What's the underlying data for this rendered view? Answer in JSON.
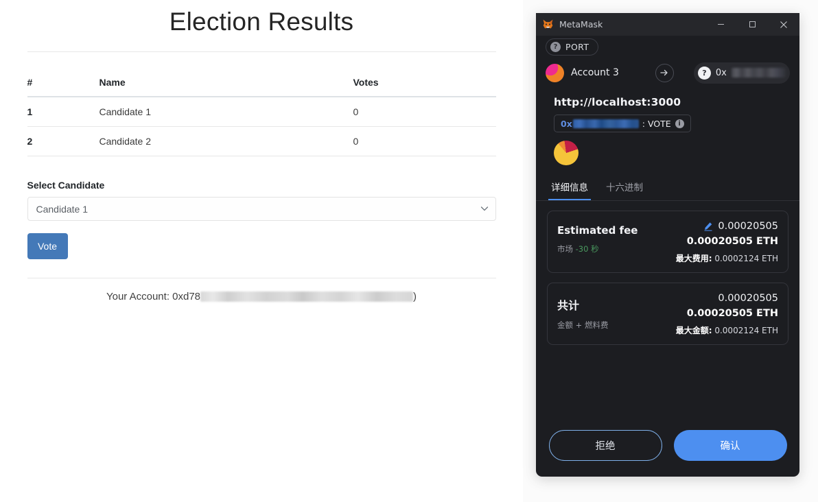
{
  "dapp": {
    "title": "Election Results",
    "table": {
      "headers": [
        "#",
        "Name",
        "Votes"
      ],
      "rows": [
        {
          "idx": "1",
          "name": "Candidate 1",
          "votes": "0"
        },
        {
          "idx": "2",
          "name": "Candidate 2",
          "votes": "0"
        }
      ]
    },
    "form": {
      "select_label": "Select Candidate",
      "select_value": "Candidate 1",
      "select_options": [
        "Candidate 1",
        "Candidate 2"
      ],
      "vote_button": "Vote",
      "chevron_icon": "chevron-down-icon"
    },
    "footer": {
      "account_prefix": "Your Account: 0xd78",
      "account_suffix": ")",
      "account_redacted": true
    }
  },
  "metamask": {
    "window": {
      "title": "MetaMask",
      "logo_icon": "metamask-fox-icon",
      "minimize_icon": "minimize-icon",
      "maximize_icon": "maximize-icon",
      "close_icon": "close-icon"
    },
    "network": {
      "name": "PORT",
      "badge_icon": "question-mark-icon"
    },
    "account": {
      "name": "Account 3",
      "avatar_icon": "account-avatar-icon",
      "arrow_icon": "arrow-right-icon",
      "recipient_prefix": "0x",
      "recipient_badge_icon": "question-mark-icon",
      "recipient_redacted": true
    },
    "request": {
      "origin": "http://localhost:3000",
      "contract_prefix": "0x",
      "method_separator": ": ",
      "method_name": "VOTE",
      "info_icon": "info-icon",
      "identicon": "contract-identicon"
    },
    "tabs": [
      {
        "label": "详细信息",
        "active": true
      },
      {
        "label": "十六进制",
        "active": false
      }
    ],
    "fee_card": {
      "title": "Estimated fee",
      "sub_label": "市场",
      "sub_time": "-30 秒",
      "edit_icon": "pencil-edit-icon",
      "amount_primary": "0.00020505",
      "amount_eth": "0.00020505 ETH",
      "max_label": "最大费用:",
      "max_value": "0.0002124 ETH"
    },
    "total_card": {
      "title": "共计",
      "sub_label": "金额 + 燃料费",
      "amount_primary": "0.00020505",
      "amount_eth": "0.00020505 ETH",
      "max_label": "最大金额:",
      "max_value": "0.0002124 ETH"
    },
    "actions": {
      "reject": "拒绝",
      "confirm": "确认"
    }
  },
  "colors": {
    "mm_bg": "#1c1d21",
    "mm_titlebar": "#26272b",
    "accent_blue": "#4d8ff0",
    "vote_button_blue": "#4479b8",
    "green": "#4a9a5f",
    "fox_orange": "#e2761b"
  }
}
